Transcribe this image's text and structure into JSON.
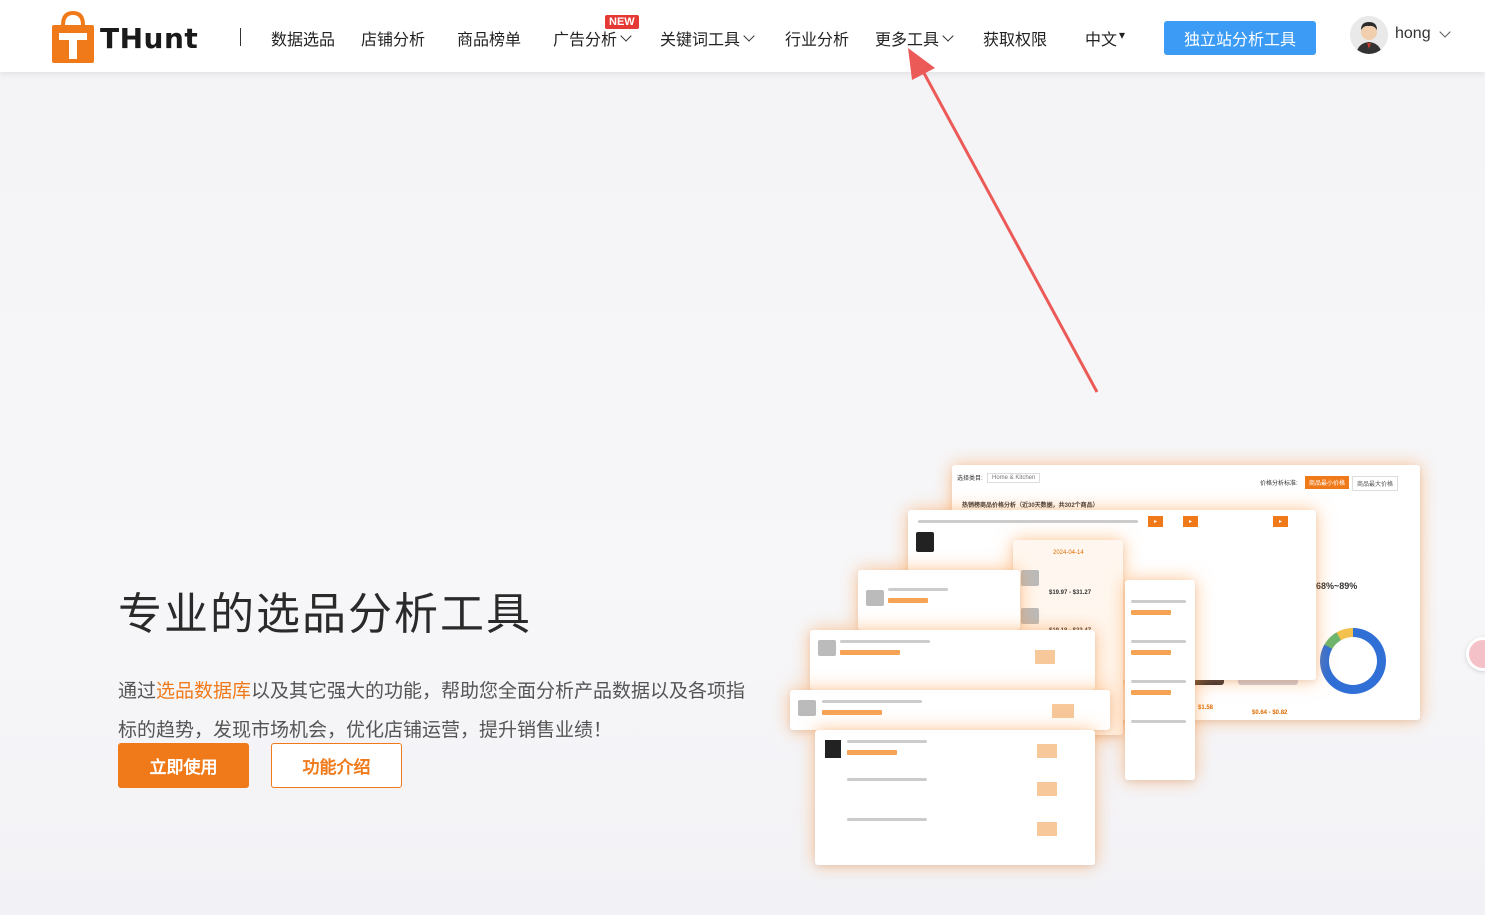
{
  "brand": {
    "name": "THunt",
    "accent": "#f07a1a",
    "blue": "#3b9bf5"
  },
  "nav": {
    "items": [
      {
        "label": "数据选品"
      },
      {
        "label": "店铺分析"
      },
      {
        "label": "商品榜单"
      },
      {
        "label": "广告分析",
        "badge": "NEW"
      },
      {
        "label": "关键词工具"
      },
      {
        "label": "行业分析"
      },
      {
        "label": "更多工具"
      },
      {
        "label": "获取权限"
      }
    ],
    "lang": "中文",
    "cta": "独立站分析工具",
    "user": {
      "name": "hong"
    }
  },
  "hero": {
    "title": "专业的选品分析工具",
    "desc_prefix": "通过",
    "desc_highlight": "选品数据库",
    "desc_rest": "以及其它强大的功能，帮助您全面分析产品数据以及各项指标的趋势，发现市场机会，优化店铺运营，提升销售业绩！",
    "primary_button": "立即使用",
    "secondary_button": "功能介绍"
  },
  "illustration": {
    "filter_label": "选择类目:",
    "category": "Home & Kitchen",
    "price_label": "价格分析标准:",
    "toggle_a": "商品最小价格",
    "toggle_b": "商品最大价格",
    "section_title": "热销榜商品价格分析（近30天数据，共302个商品）",
    "date_a": "2024-04-14",
    "range_pct": "68%~89%",
    "price_1": "$19.97 - $31.27",
    "price_2": "$19.18 - $23.47",
    "price_3": "$0.64 - $0.82",
    "price_4": "$1.58",
    "icons": [
      "shopping-bag-icon",
      "chevron-down-icon",
      "donut-chart-icon"
    ]
  }
}
